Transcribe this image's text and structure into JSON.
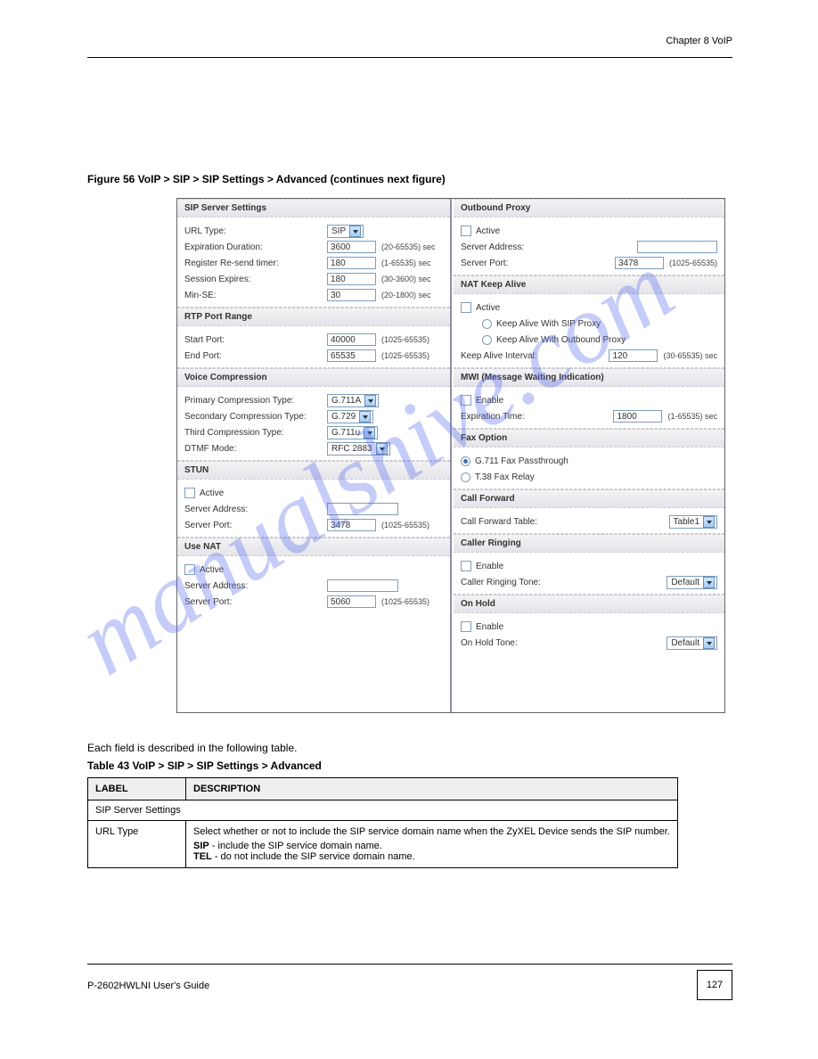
{
  "chapter": "Chapter 8 VoIP",
  "figure_caption": "Figure 56   VoIP > SIP > SIP Settings > Advanced (continues next figure)",
  "table_intro": "Each field is described in the following table.",
  "table_caption": "Table 43   VoIP > SIP > SIP Settings > Advanced",
  "page_number": "127",
  "guide_label": "P-2602HWLNI User's Guide",
  "table_headers": {
    "label": "LABEL",
    "description": "DESCRIPTION"
  },
  "table_section": "SIP Server Settings",
  "table_row_label": "URL Type",
  "table_row_desc_lines": [
    "Select whether or not to include the SIP service domain name when the ZyXEL Device sends the SIP number.",
    "SIP - include the SIP service domain name.",
    "TEL - do not include the SIP service domain name."
  ],
  "left": {
    "sip_server": {
      "title": "SIP Server Settings",
      "url_type_label": "URL Type:",
      "url_type_value": "SIP",
      "exp_dur_label": "Expiration Duration:",
      "exp_dur_value": "3600",
      "exp_dur_hint": "(20-65535) sec",
      "reg_label": "Register Re-send timer:",
      "reg_value": "180",
      "reg_hint": "(1-65535) sec",
      "sess_label": "Session Expires:",
      "sess_value": "180",
      "sess_hint": "(30-3600) sec",
      "minse_label": "Min-SE:",
      "minse_value": "30",
      "minse_hint": "(20-1800) sec"
    },
    "rtp": {
      "title": "RTP Port Range",
      "start_label": "Start Port:",
      "start_value": "40000",
      "start_hint": "(1025-65535)",
      "end_label": "End Port:",
      "end_value": "65535",
      "end_hint": "(1025-65535)"
    },
    "voice": {
      "title": "Voice Compression",
      "p1_label": "Primary Compression Type:",
      "p1_value": "G.711A",
      "p2_label": "Secondary Compression Type:",
      "p2_value": "G.729",
      "p3_label": "Third Compression Type:",
      "p3_value": "G.711u",
      "dtmf_label": "DTMF Mode:",
      "dtmf_value": "RFC 2883"
    },
    "stun": {
      "title": "STUN",
      "active": "Active",
      "addr_label": "Server Address:",
      "port_label": "Server Port:",
      "port_value": "3478",
      "port_hint": "(1025-65535)"
    },
    "nat": {
      "title": "Use NAT",
      "active": "Active",
      "addr_label": "Server Address:",
      "port_label": "Server Port:",
      "port_value": "5060",
      "port_hint": "(1025-65535)"
    }
  },
  "right": {
    "outbound": {
      "title": "Outbound Proxy",
      "active": "Active",
      "addr_label": "Server Address:",
      "port_label": "Server Port:",
      "port_value": "3478",
      "port_hint": "(1025-65535)"
    },
    "keepalive": {
      "title": "NAT Keep Alive",
      "active": "Active",
      "opt1": "Keep Alive With SIP Proxy",
      "opt2": "Keep Alive With Outbound Proxy",
      "interval_label": "Keep Alive Interval:",
      "interval_value": "120",
      "interval_hint": "(30-65535) sec"
    },
    "mwi": {
      "title": "MWI (Message Waiting Indication)",
      "enable": "Enable",
      "exp_label": "Expiration Time:",
      "exp_value": "1800",
      "exp_hint": "(1-65535) sec"
    },
    "fax": {
      "title": "Fax Option",
      "opt1": "G.711 Fax Passthrough",
      "opt2": "T.38 Fax Relay"
    },
    "callfwd": {
      "title": "Call Forward",
      "label": "Call Forward Table:",
      "value": "Table1"
    },
    "ringing": {
      "title": "Caller Ringing",
      "enable": "Enable",
      "label": "Caller Ringing Tone:",
      "value": "Default"
    },
    "onhold": {
      "title": "On Hold",
      "enable": "Enable",
      "label": "On Hold Tone:",
      "value": "Default"
    }
  }
}
